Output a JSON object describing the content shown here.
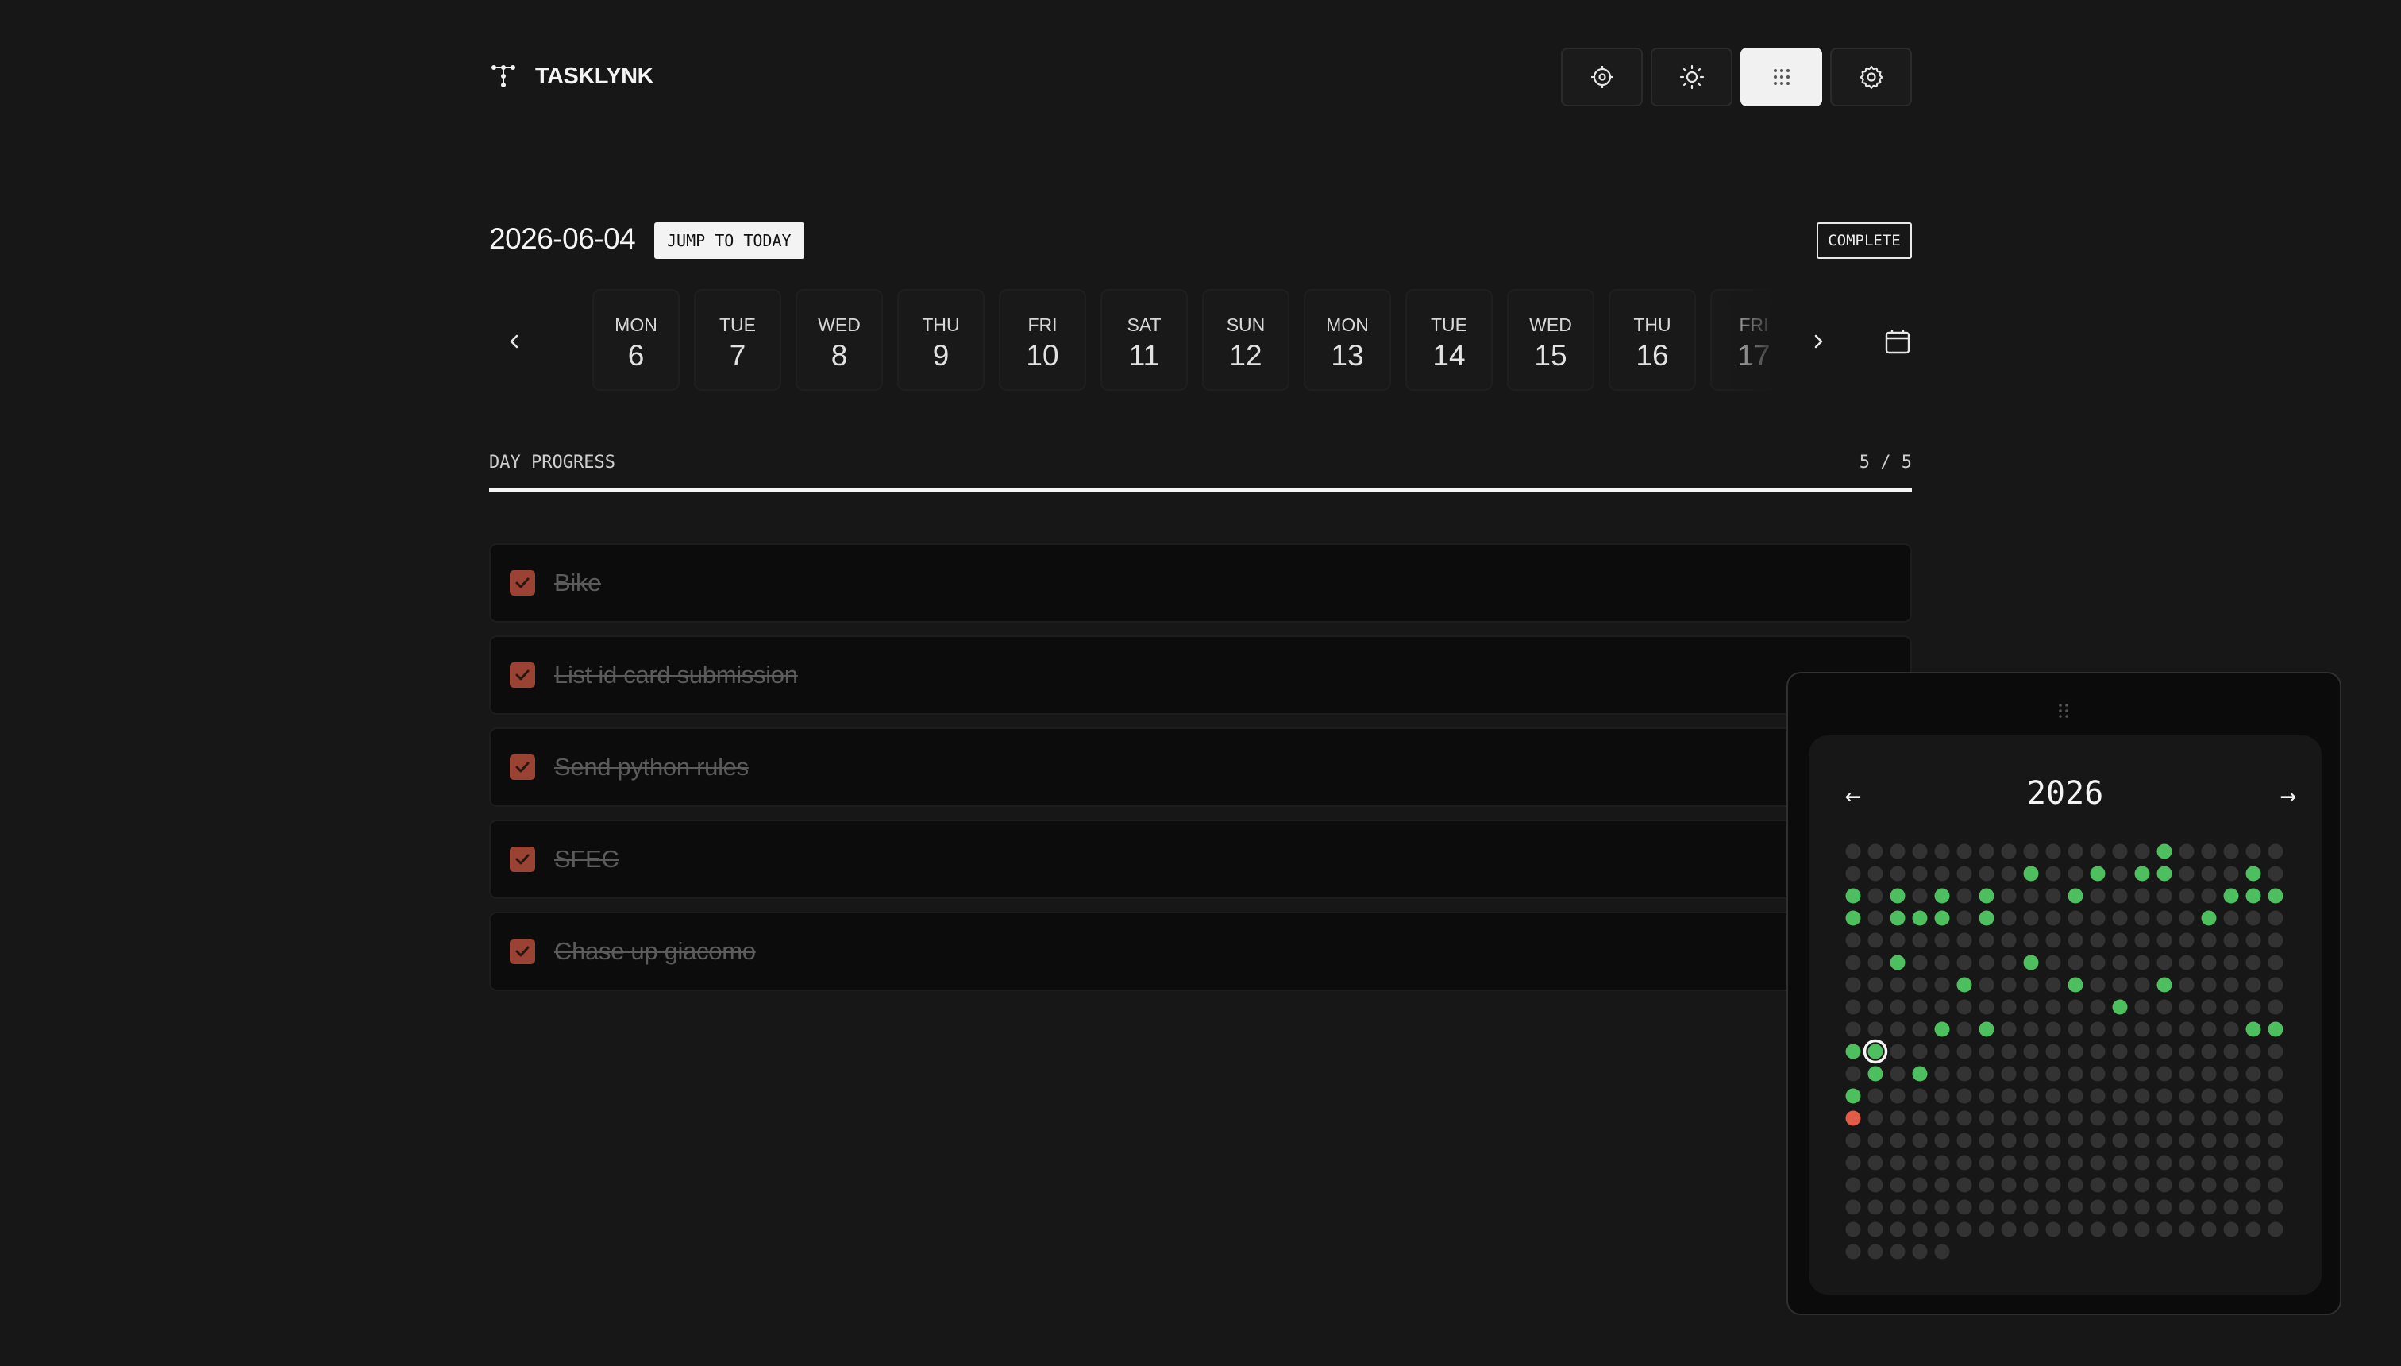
{
  "app": {
    "name": "TASKLYNK"
  },
  "header_buttons": [
    {
      "name": "focus-button",
      "icon": "crosshair-icon"
    },
    {
      "name": "theme-toggle-button",
      "icon": "sun-icon"
    },
    {
      "name": "grid-view-button",
      "icon": "dot-grid-icon",
      "active": true
    },
    {
      "name": "settings-button",
      "icon": "gear-icon"
    }
  ],
  "date": {
    "current": "2026-06-04",
    "jump_label": "JUMP TO TODAY",
    "complete_label": "COMPLETE"
  },
  "week": [
    {
      "dow": "MON",
      "num": "6"
    },
    {
      "dow": "TUE",
      "num": "7"
    },
    {
      "dow": "WED",
      "num": "8"
    },
    {
      "dow": "THU",
      "num": "9"
    },
    {
      "dow": "FRI",
      "num": "10"
    },
    {
      "dow": "SAT",
      "num": "11"
    },
    {
      "dow": "SUN",
      "num": "12"
    },
    {
      "dow": "MON",
      "num": "13"
    },
    {
      "dow": "TUE",
      "num": "14"
    },
    {
      "dow": "WED",
      "num": "15"
    },
    {
      "dow": "THU",
      "num": "16"
    },
    {
      "dow": "FRI",
      "num": "17"
    }
  ],
  "progress": {
    "label": "DAY PROGRESS",
    "count": "5 / 5",
    "fraction": 1.0
  },
  "tasks": [
    {
      "text": "Bike ",
      "done": true
    },
    {
      "text": "List id card submission",
      "done": true
    },
    {
      "text": "Send python rules",
      "done": true
    },
    {
      "text": "SFEC",
      "done": true
    },
    {
      "text": "Chase up giacomo ",
      "done": true
    }
  ],
  "year_widget": {
    "year": "2026",
    "prev_symbol": "←",
    "next_symbol": "→",
    "total_days": 365,
    "colors": {
      "empty": "#333333",
      "done": "#4ebf5f",
      "missed": "#e25c4a",
      "today_ring": "#f4f4f4"
    },
    "done_days": [
      14,
      28,
      31,
      33,
      34,
      38,
      40,
      42,
      44,
      46,
      50,
      57,
      58,
      59,
      60,
      62,
      63,
      64,
      66,
      76,
      102,
      108,
      125,
      130,
      134,
      152,
      164,
      166,
      178,
      179,
      180,
      201,
      203,
      220
    ],
    "missed_days": [
      240
    ],
    "today_index": 181
  }
}
